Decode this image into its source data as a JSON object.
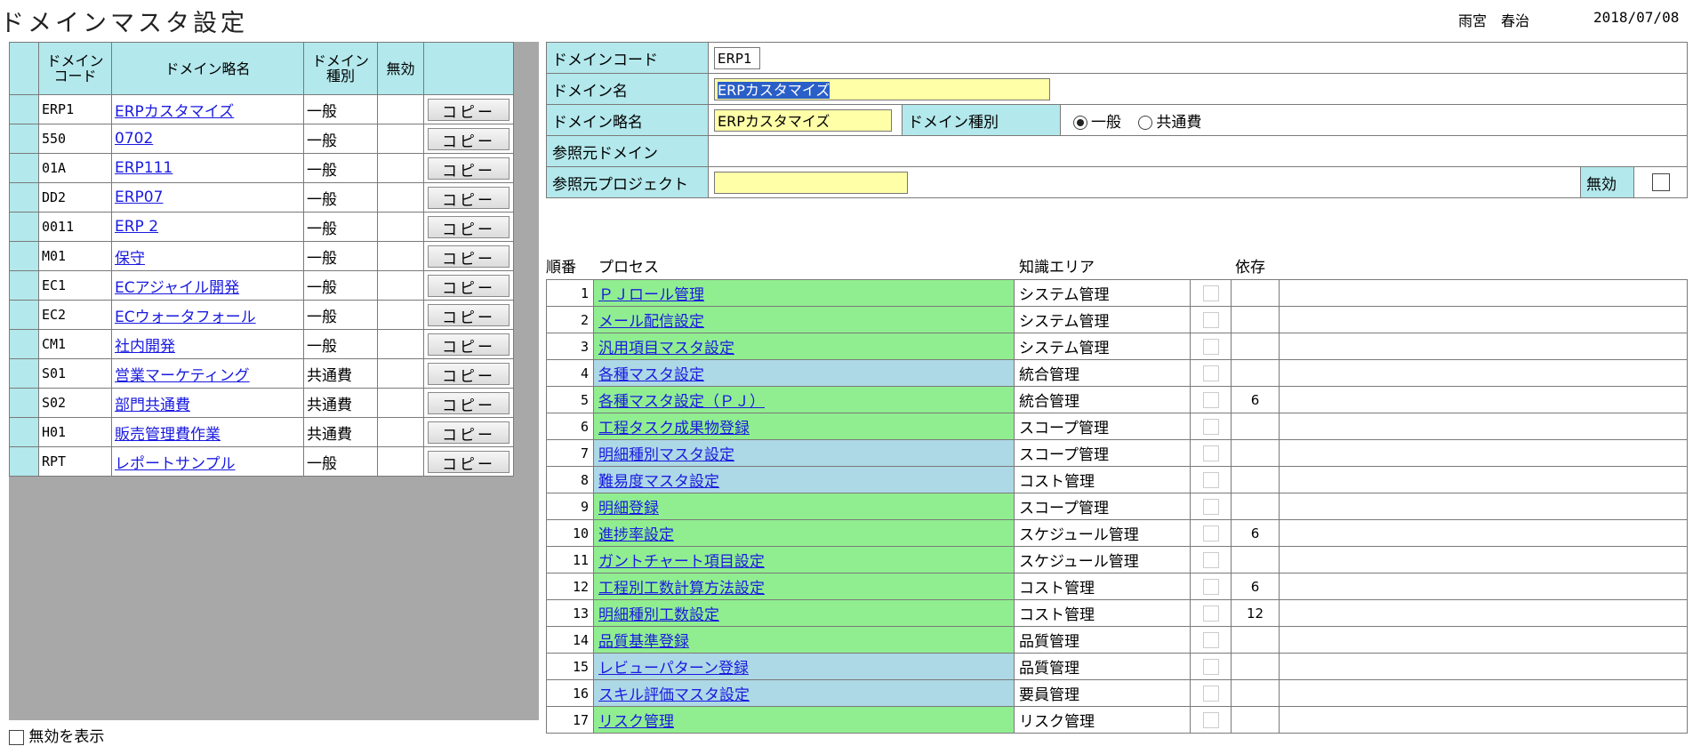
{
  "header": {
    "title": "ドメインマスタ設定",
    "user_name": "雨宮　春治",
    "date": "2018/07/08"
  },
  "domain_list": {
    "columns": {
      "code": "ドメイン\nコード",
      "short_name": "ドメイン略名",
      "kind": "ドメイン\n種別",
      "invalid": "無効"
    },
    "copy_label": "コピー",
    "rows": [
      {
        "code": "ERP1",
        "name": "ERPカスタマイズ",
        "kind": "一般"
      },
      {
        "code": "550",
        "name": "0702",
        "kind": "一般"
      },
      {
        "code": "01A",
        "name": "ERP111",
        "kind": "一般"
      },
      {
        "code": "DD2",
        "name": "ERP07",
        "kind": "一般"
      },
      {
        "code": "0011",
        "name": "ERP 2",
        "kind": "一般"
      },
      {
        "code": "M01",
        "name": "保守",
        "kind": "一般"
      },
      {
        "code": "EC1",
        "name": "ECアジャイル開発",
        "kind": "一般"
      },
      {
        "code": "EC2",
        "name": "ECウォータフォール",
        "kind": "一般"
      },
      {
        "code": "CM1",
        "name": "社内開発",
        "kind": "一般"
      },
      {
        "code": "S01",
        "name": "営業マーケティング",
        "kind": "共通費"
      },
      {
        "code": "S02",
        "name": "部門共通費",
        "kind": "共通費"
      },
      {
        "code": "H01",
        "name": "販売管理費作業",
        "kind": "共通費"
      },
      {
        "code": "RPT",
        "name": "レポートサンプル",
        "kind": "一般"
      }
    ],
    "show_invalid_label": "無効を表示"
  },
  "form": {
    "domain_code_label": "ドメインコード",
    "domain_code_value": "ERP1",
    "domain_name_label": "ドメイン名",
    "domain_name_value": "ERPカスタマイズ",
    "domain_short_label": "ドメイン略名",
    "domain_short_value": "ERPカスタマイズ",
    "domain_kind_label": "ドメイン種別",
    "kind_option_general": "一般",
    "kind_option_common": "共通費",
    "ref_domain_label": "参照元ドメイン",
    "ref_project_label": "参照元プロジェクト",
    "invalid_label": "無効"
  },
  "process_table": {
    "headers": {
      "order": "順番",
      "process": "プロセス",
      "knowledge_area": "知識エリア",
      "dependency": "依存"
    },
    "rows": [
      {
        "no": "1",
        "name": "ＰＪロール管理",
        "area": "システム管理",
        "dep": "",
        "color": "green"
      },
      {
        "no": "2",
        "name": "メール配信設定",
        "area": "システム管理",
        "dep": "",
        "color": "green"
      },
      {
        "no": "3",
        "name": "汎用項目マスタ設定",
        "area": "システム管理",
        "dep": "",
        "color": "green"
      },
      {
        "no": "4",
        "name": "各種マスタ設定",
        "area": "統合管理",
        "dep": "",
        "color": "blue"
      },
      {
        "no": "5",
        "name": "各種マスタ設定（ＰＪ）",
        "area": "統合管理",
        "dep": "6",
        "color": "green"
      },
      {
        "no": "6",
        "name": "工程タスク成果物登録",
        "area": "スコープ管理",
        "dep": "",
        "color": "green"
      },
      {
        "no": "7",
        "name": "明細種別マスタ設定",
        "area": "スコープ管理",
        "dep": "",
        "color": "blue"
      },
      {
        "no": "8",
        "name": "難易度マスタ設定",
        "area": "コスト管理",
        "dep": "",
        "color": "blue"
      },
      {
        "no": "9",
        "name": "明細登録",
        "area": "スコープ管理",
        "dep": "",
        "color": "green"
      },
      {
        "no": "10",
        "name": "進捗率設定",
        "area": "スケジュール管理",
        "dep": "6",
        "color": "green"
      },
      {
        "no": "11",
        "name": "ガントチャート項目設定",
        "area": "スケジュール管理",
        "dep": "",
        "color": "green"
      },
      {
        "no": "12",
        "name": "工程別工数計算方法設定",
        "area": "コスト管理",
        "dep": "6",
        "color": "green"
      },
      {
        "no": "13",
        "name": "明細種別工数設定",
        "area": "コスト管理",
        "dep": "12",
        "color": "green"
      },
      {
        "no": "14",
        "name": "品質基準登録",
        "area": "品質管理",
        "dep": "",
        "color": "green"
      },
      {
        "no": "15",
        "name": "レビューパターン登録",
        "area": "品質管理",
        "dep": "",
        "color": "blue"
      },
      {
        "no": "16",
        "name": "スキル評価マスタ設定",
        "area": "要員管理",
        "dep": "",
        "color": "blue"
      },
      {
        "no": "17",
        "name": "リスク管理",
        "area": "リスク管理",
        "dep": "",
        "color": "green"
      }
    ]
  },
  "colors": {
    "header_cyan": "#b3e8ec",
    "row_green": "#90ee90",
    "row_blue": "#add8e6",
    "input_yellow": "#ffffa8",
    "link_blue": "#1a1ae0"
  }
}
